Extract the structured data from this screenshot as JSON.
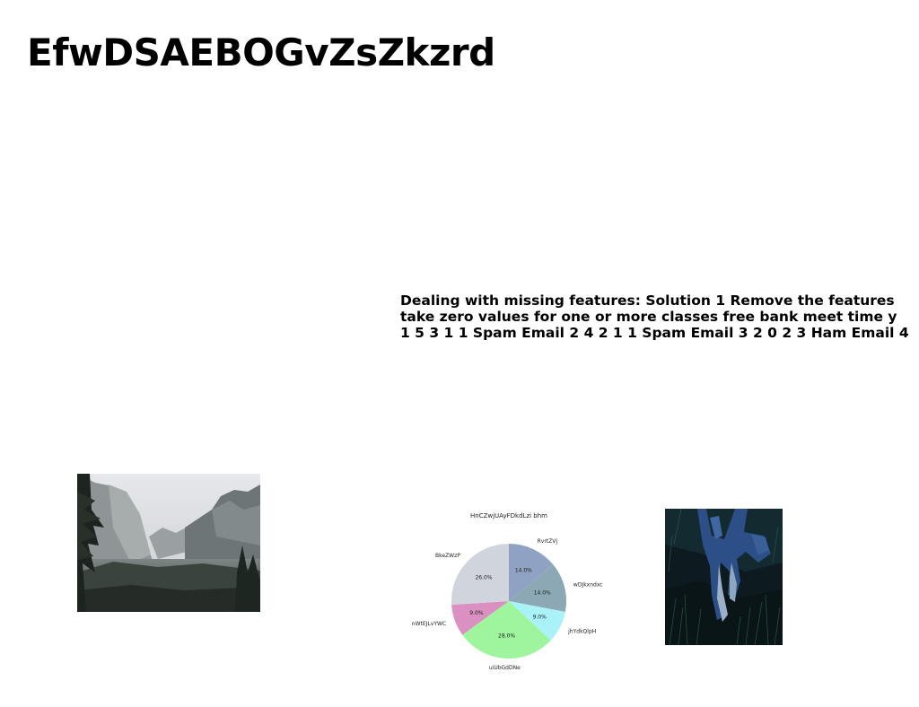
{
  "document": {
    "title": "EfwDSAEBOGvZsZkzrd",
    "text_lines": [
      "Dealing with missing features: Solution 1 Remove the features",
      "take zero values for one or more classes free bank meet time y",
      "1 5 3 1 1 Spam Email 2 4 2 1 1 Spam Email 3 2 0 2 3 Ham Email 4"
    ]
  },
  "images": [
    {
      "name": "landscape-photo"
    },
    {
      "name": "dark-grass-photo"
    }
  ],
  "chart_data": {
    "type": "pie",
    "title": "HnCZwjUAyFDkdLzi bhm",
    "slices": [
      {
        "label": "RvrtZVj",
        "value": 14.0,
        "display": "14.0%",
        "color": "#8fa2c4"
      },
      {
        "label": "wDJkxndxc",
        "value": 14.0,
        "display": "14.0%",
        "color": "#8ca8b4"
      },
      {
        "label": "jhYdkQlpH",
        "value": 9.0,
        "display": "9.0%",
        "color": "#a9f3f8"
      },
      {
        "label": "uiUbGdDNe",
        "value": 28.0,
        "display": "28.0%",
        "color": "#9ef59e"
      },
      {
        "label": "nWtEJLvYWC",
        "value": 9.0,
        "display": "9.0%",
        "color": "#da90c0"
      },
      {
        "label": "BkeZWzP",
        "value": 26.0,
        "display": "26.0%",
        "color": "#d0d4dc"
      }
    ],
    "start_angle_deg": 90,
    "direction": "clockwise"
  }
}
